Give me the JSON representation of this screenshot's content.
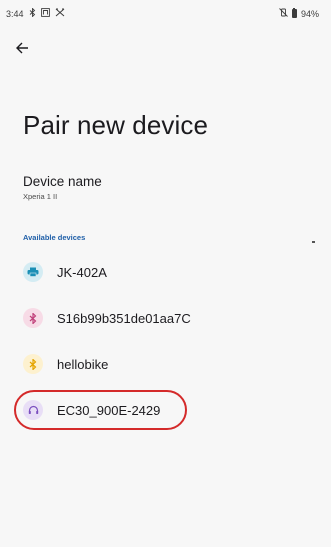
{
  "status_bar": {
    "time": "3:44",
    "left_icons": [
      "bluetooth-icon",
      "nfc-icon",
      "tool-icon"
    ],
    "right_icons": [
      "vibrate-mute-icon",
      "battery-icon"
    ],
    "battery_percent": "94%"
  },
  "header": {
    "back_icon": "arrow-back-icon",
    "title": "Pair new device"
  },
  "device_name": {
    "label": "Device name",
    "value": "Xperia 1 II"
  },
  "available_devices": {
    "header": "Available devices",
    "items": [
      {
        "label": "JK-402A",
        "icon": "printer-icon",
        "icon_bg": "#d4ecf3",
        "icon_fg": "#1a8fb5"
      },
      {
        "label": "S16b99b351de01aa7C",
        "icon": "bluetooth-icon",
        "icon_bg": "#f7dbe6",
        "icon_fg": "#c0407a"
      },
      {
        "label": "hellobike",
        "icon": "bluetooth-icon",
        "icon_bg": "#fdf1cf",
        "icon_fg": "#e4a400"
      },
      {
        "label": "EC30_900E-2429",
        "icon": "headset-icon",
        "icon_bg": "#e8def6",
        "icon_fg": "#7b4fbf"
      }
    ]
  },
  "colors": {
    "highlight_ring": "#d42a2a",
    "section_header": "#1f5fa8"
  }
}
